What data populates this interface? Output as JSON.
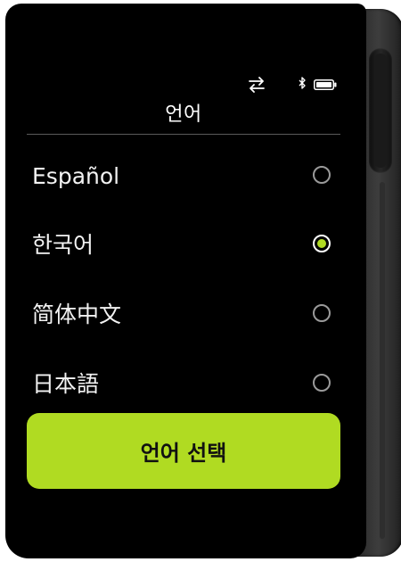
{
  "header": {
    "title": "언어",
    "status_icons": [
      "swap-arrows-icon",
      "bluetooth-icon",
      "battery-icon"
    ]
  },
  "languages": [
    {
      "label": "Español",
      "selected": false
    },
    {
      "label": "한국어",
      "selected": true
    },
    {
      "label": "简体中文",
      "selected": false
    },
    {
      "label": "日本語",
      "selected": false
    }
  ],
  "action": {
    "label": "언어 선택"
  },
  "colors": {
    "accent": "#b0db22",
    "background": "#000000",
    "text": "#ffffff",
    "divider": "#5a5a5a"
  }
}
